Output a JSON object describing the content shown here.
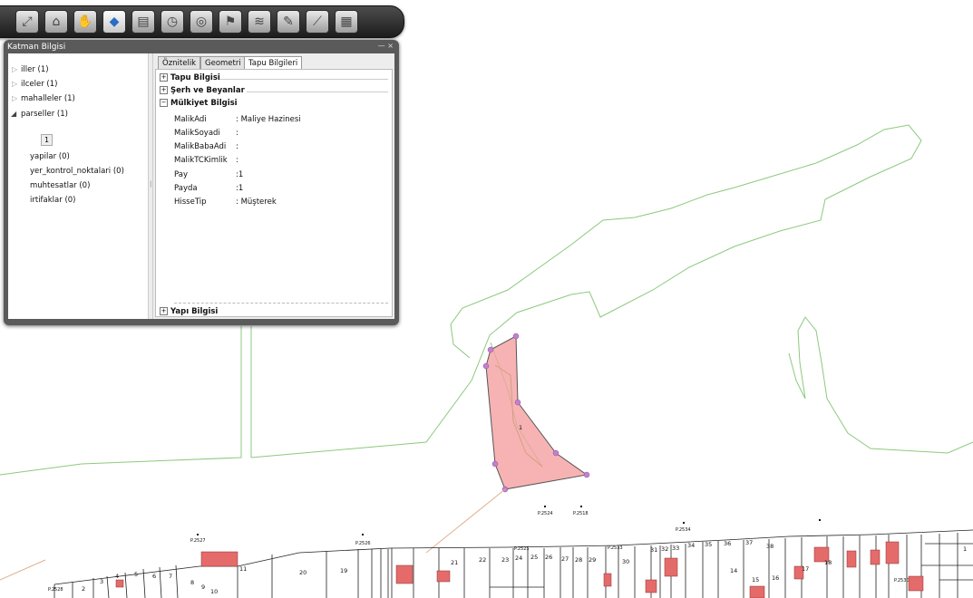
{
  "panel": {
    "title": "Katman Bilgisi",
    "window_buttons": "— ×"
  },
  "layers": [
    {
      "label": "iller (1)"
    },
    {
      "label": "ilceler (1)"
    },
    {
      "label": "mahalleler (1)"
    },
    {
      "label": "parseller (1)"
    },
    {
      "label": "yapilar (0)"
    },
    {
      "label": "yer_kontrol_noktalari (0)"
    },
    {
      "label": "muhtesatlar (0)"
    },
    {
      "label": "irtifaklar (0)"
    }
  ],
  "selected_feature": "1",
  "tabs": [
    {
      "label": "Öznitelik"
    },
    {
      "label": "Geometri"
    },
    {
      "label": "Tapu Bilgileri"
    }
  ],
  "sections": {
    "tapu_bilgisi": "Tapu Bilgisi",
    "serh": "Şerh ve Beyanlar",
    "mulkiyet": "Mülkiyet Bilgisi",
    "yapi": "Yapı Bilgisi"
  },
  "fields": [
    {
      "label": "MalikAdi",
      "value": ": Maliye Hazinesi"
    },
    {
      "label": "MalikSoyadi",
      "value": ":"
    },
    {
      "label": "MalikBabaAdi",
      "value": ":"
    },
    {
      "label": "MalikTCKimlik",
      "value": ":"
    },
    {
      "label": "Pay",
      "value": ":1"
    },
    {
      "label": "Payda",
      "value": ":1"
    },
    {
      "label": "HisseTip",
      "value": ": Müşterek"
    }
  ],
  "map": {
    "selected_parcel_label": "1",
    "points": [
      "P.2527",
      "P.2526",
      "P.2524",
      "P.2518",
      "P.2534",
      "P.2525",
      "P.2533",
      "P.2528",
      "P.2530"
    ],
    "parcel_numbers": [
      "1",
      "2",
      "3",
      "4",
      "5",
      "6",
      "7",
      "8",
      "9",
      "10",
      "11",
      "14",
      "15",
      "16",
      "17",
      "18",
      "19",
      "20",
      "21",
      "22",
      "23",
      "24",
      "25",
      "26",
      "27",
      "28",
      "29",
      "30",
      "31",
      "32",
      "33",
      "34",
      "35",
      "36",
      "37",
      "38"
    ]
  },
  "colors": {
    "selection_fill": "#f5a0a0",
    "selection_vertex": "#c47fcf",
    "boundary": "#8cc97e",
    "building": "#e56b6b"
  }
}
